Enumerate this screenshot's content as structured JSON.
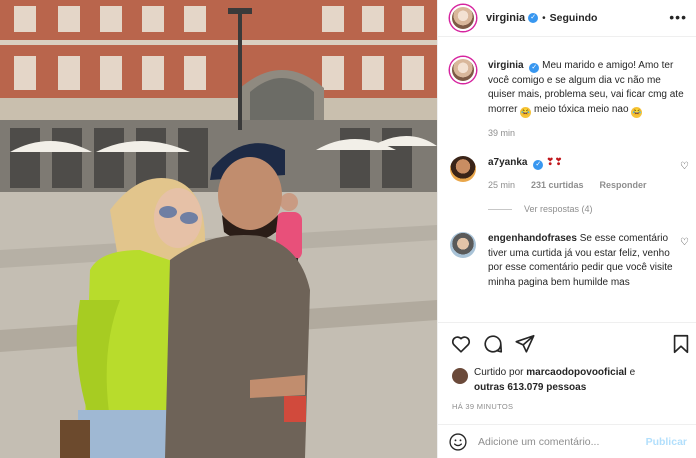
{
  "post": {
    "username": "virginia",
    "follow_status": "Seguindo",
    "caption_text": "Meu marido e amigo! Amo ter você comigo e se algum dia vc não me quiser mais, problema seu, vai ficar cmg ate morrer",
    "caption_text_2": "meio tóxica meio nao",
    "caption_time": "39 min"
  },
  "comments": [
    {
      "username": "a7yanka",
      "time": "25 min",
      "likes": "231 curtidas",
      "reply": "Responder",
      "view_replies": "Ver respostas (4)"
    },
    {
      "username": "engenhandofrases",
      "text": "Se esse comentário tiver uma curtida já vou estar feliz, venho por esse comentário pedir que você visite minha pagina bem humilde mas"
    }
  ],
  "likes": {
    "prefix": "Curtido por",
    "user": "marcaodopovooficial",
    "conj": "e",
    "others": "outras 613.079 pessoas"
  },
  "timestamp": "HÁ 39 MINUTOS",
  "add_comment": {
    "placeholder": "Adicione um comentário...",
    "post_label": "Publicar"
  },
  "icons": [
    "more-icon",
    "verified-icon",
    "heart-icon",
    "comment-icon",
    "share-icon",
    "bookmark-icon",
    "emoji-icon"
  ]
}
